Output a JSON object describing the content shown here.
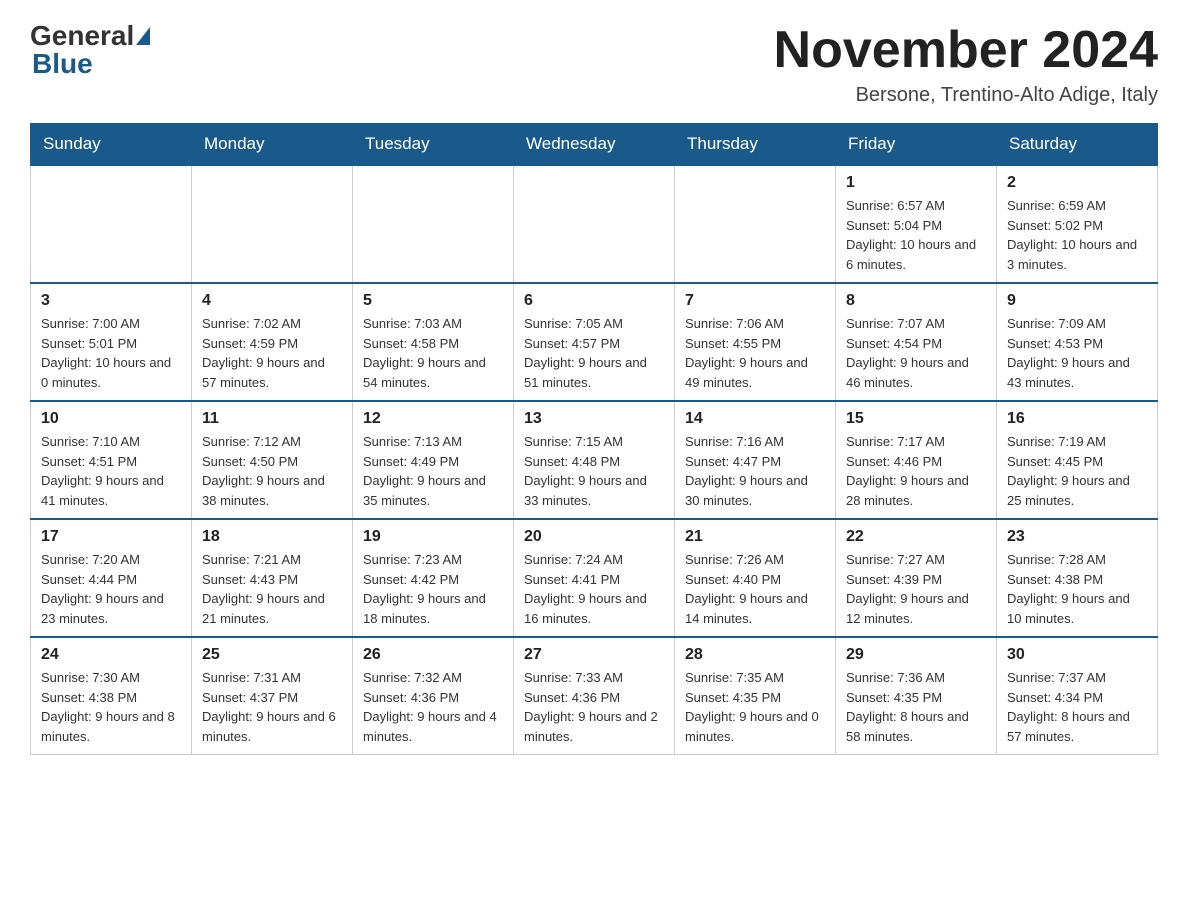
{
  "header": {
    "logo_general": "General",
    "logo_blue": "Blue",
    "month_title": "November 2024",
    "location": "Bersone, Trentino-Alto Adige, Italy"
  },
  "weekdays": [
    "Sunday",
    "Monday",
    "Tuesday",
    "Wednesday",
    "Thursday",
    "Friday",
    "Saturday"
  ],
  "weeks": [
    [
      {
        "day": "",
        "sunrise": "",
        "sunset": "",
        "daylight": ""
      },
      {
        "day": "",
        "sunrise": "",
        "sunset": "",
        "daylight": ""
      },
      {
        "day": "",
        "sunrise": "",
        "sunset": "",
        "daylight": ""
      },
      {
        "day": "",
        "sunrise": "",
        "sunset": "",
        "daylight": ""
      },
      {
        "day": "",
        "sunrise": "",
        "sunset": "",
        "daylight": ""
      },
      {
        "day": "1",
        "sunrise": "Sunrise: 6:57 AM",
        "sunset": "Sunset: 5:04 PM",
        "daylight": "Daylight: 10 hours and 6 minutes."
      },
      {
        "day": "2",
        "sunrise": "Sunrise: 6:59 AM",
        "sunset": "Sunset: 5:02 PM",
        "daylight": "Daylight: 10 hours and 3 minutes."
      }
    ],
    [
      {
        "day": "3",
        "sunrise": "Sunrise: 7:00 AM",
        "sunset": "Sunset: 5:01 PM",
        "daylight": "Daylight: 10 hours and 0 minutes."
      },
      {
        "day": "4",
        "sunrise": "Sunrise: 7:02 AM",
        "sunset": "Sunset: 4:59 PM",
        "daylight": "Daylight: 9 hours and 57 minutes."
      },
      {
        "day": "5",
        "sunrise": "Sunrise: 7:03 AM",
        "sunset": "Sunset: 4:58 PM",
        "daylight": "Daylight: 9 hours and 54 minutes."
      },
      {
        "day": "6",
        "sunrise": "Sunrise: 7:05 AM",
        "sunset": "Sunset: 4:57 PM",
        "daylight": "Daylight: 9 hours and 51 minutes."
      },
      {
        "day": "7",
        "sunrise": "Sunrise: 7:06 AM",
        "sunset": "Sunset: 4:55 PM",
        "daylight": "Daylight: 9 hours and 49 minutes."
      },
      {
        "day": "8",
        "sunrise": "Sunrise: 7:07 AM",
        "sunset": "Sunset: 4:54 PM",
        "daylight": "Daylight: 9 hours and 46 minutes."
      },
      {
        "day": "9",
        "sunrise": "Sunrise: 7:09 AM",
        "sunset": "Sunset: 4:53 PM",
        "daylight": "Daylight: 9 hours and 43 minutes."
      }
    ],
    [
      {
        "day": "10",
        "sunrise": "Sunrise: 7:10 AM",
        "sunset": "Sunset: 4:51 PM",
        "daylight": "Daylight: 9 hours and 41 minutes."
      },
      {
        "day": "11",
        "sunrise": "Sunrise: 7:12 AM",
        "sunset": "Sunset: 4:50 PM",
        "daylight": "Daylight: 9 hours and 38 minutes."
      },
      {
        "day": "12",
        "sunrise": "Sunrise: 7:13 AM",
        "sunset": "Sunset: 4:49 PM",
        "daylight": "Daylight: 9 hours and 35 minutes."
      },
      {
        "day": "13",
        "sunrise": "Sunrise: 7:15 AM",
        "sunset": "Sunset: 4:48 PM",
        "daylight": "Daylight: 9 hours and 33 minutes."
      },
      {
        "day": "14",
        "sunrise": "Sunrise: 7:16 AM",
        "sunset": "Sunset: 4:47 PM",
        "daylight": "Daylight: 9 hours and 30 minutes."
      },
      {
        "day": "15",
        "sunrise": "Sunrise: 7:17 AM",
        "sunset": "Sunset: 4:46 PM",
        "daylight": "Daylight: 9 hours and 28 minutes."
      },
      {
        "day": "16",
        "sunrise": "Sunrise: 7:19 AM",
        "sunset": "Sunset: 4:45 PM",
        "daylight": "Daylight: 9 hours and 25 minutes."
      }
    ],
    [
      {
        "day": "17",
        "sunrise": "Sunrise: 7:20 AM",
        "sunset": "Sunset: 4:44 PM",
        "daylight": "Daylight: 9 hours and 23 minutes."
      },
      {
        "day": "18",
        "sunrise": "Sunrise: 7:21 AM",
        "sunset": "Sunset: 4:43 PM",
        "daylight": "Daylight: 9 hours and 21 minutes."
      },
      {
        "day": "19",
        "sunrise": "Sunrise: 7:23 AM",
        "sunset": "Sunset: 4:42 PM",
        "daylight": "Daylight: 9 hours and 18 minutes."
      },
      {
        "day": "20",
        "sunrise": "Sunrise: 7:24 AM",
        "sunset": "Sunset: 4:41 PM",
        "daylight": "Daylight: 9 hours and 16 minutes."
      },
      {
        "day": "21",
        "sunrise": "Sunrise: 7:26 AM",
        "sunset": "Sunset: 4:40 PM",
        "daylight": "Daylight: 9 hours and 14 minutes."
      },
      {
        "day": "22",
        "sunrise": "Sunrise: 7:27 AM",
        "sunset": "Sunset: 4:39 PM",
        "daylight": "Daylight: 9 hours and 12 minutes."
      },
      {
        "day": "23",
        "sunrise": "Sunrise: 7:28 AM",
        "sunset": "Sunset: 4:38 PM",
        "daylight": "Daylight: 9 hours and 10 minutes."
      }
    ],
    [
      {
        "day": "24",
        "sunrise": "Sunrise: 7:30 AM",
        "sunset": "Sunset: 4:38 PM",
        "daylight": "Daylight: 9 hours and 8 minutes."
      },
      {
        "day": "25",
        "sunrise": "Sunrise: 7:31 AM",
        "sunset": "Sunset: 4:37 PM",
        "daylight": "Daylight: 9 hours and 6 minutes."
      },
      {
        "day": "26",
        "sunrise": "Sunrise: 7:32 AM",
        "sunset": "Sunset: 4:36 PM",
        "daylight": "Daylight: 9 hours and 4 minutes."
      },
      {
        "day": "27",
        "sunrise": "Sunrise: 7:33 AM",
        "sunset": "Sunset: 4:36 PM",
        "daylight": "Daylight: 9 hours and 2 minutes."
      },
      {
        "day": "28",
        "sunrise": "Sunrise: 7:35 AM",
        "sunset": "Sunset: 4:35 PM",
        "daylight": "Daylight: 9 hours and 0 minutes."
      },
      {
        "day": "29",
        "sunrise": "Sunrise: 7:36 AM",
        "sunset": "Sunset: 4:35 PM",
        "daylight": "Daylight: 8 hours and 58 minutes."
      },
      {
        "day": "30",
        "sunrise": "Sunrise: 7:37 AM",
        "sunset": "Sunset: 4:34 PM",
        "daylight": "Daylight: 8 hours and 57 minutes."
      }
    ]
  ]
}
